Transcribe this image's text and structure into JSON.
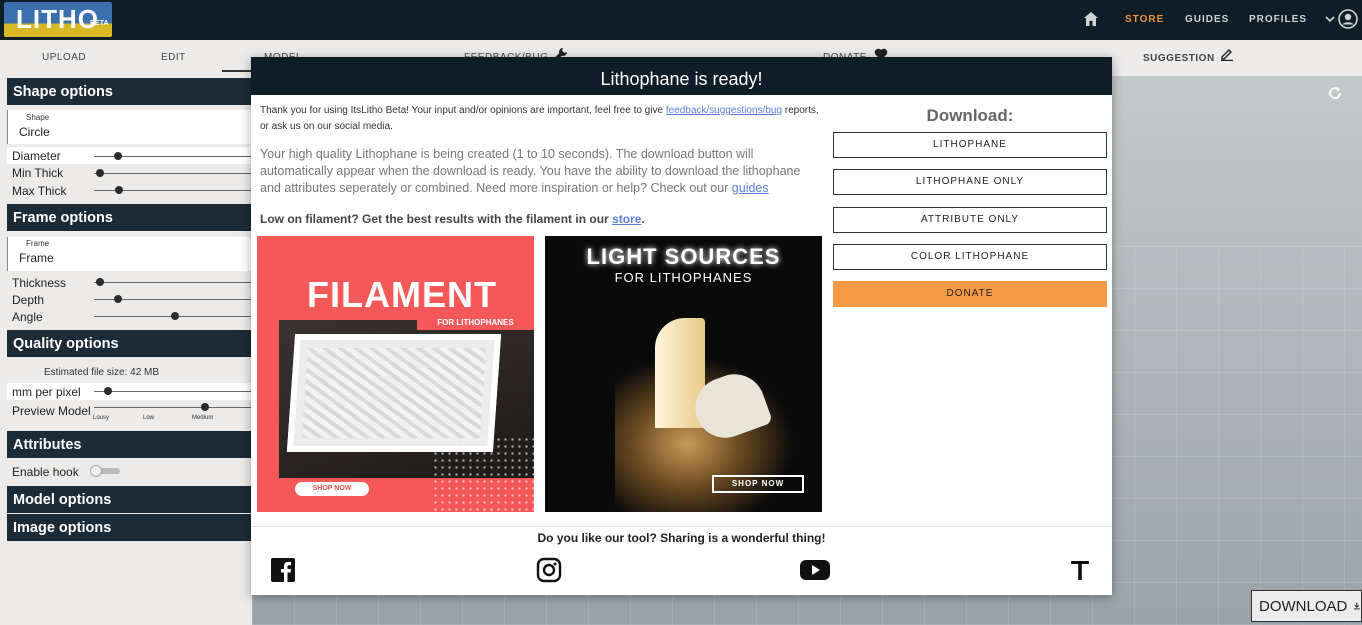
{
  "app": {
    "logo_text": "LITHO",
    "logo_badge": "BETA"
  },
  "nav": {
    "links": [
      "STORE",
      "GUIDES",
      "PROFILES"
    ],
    "accent_color": "#f0913a"
  },
  "tabs": {
    "items": [
      "UPLOAD",
      "EDIT",
      "MODEL",
      "FEEDBACK/BUG",
      "DONATE",
      "SUGGESTION"
    ],
    "active": "MODEL"
  },
  "sidebar": {
    "shape_section": "Shape options",
    "shape_label": "Shape",
    "shape_value": "Circle",
    "diameter": "Diameter",
    "diameter_level": 0.15,
    "min_thick": "Min Thick",
    "min_thick_level": 0.04,
    "max_thick": "Max Thick",
    "max_thick_level": 0.16,
    "frame_section": "Frame options",
    "frame_label": "Frame",
    "frame_value": "Frame",
    "thickness": "Thickness",
    "thickness_level": 0.04,
    "depth": "Depth",
    "depth_level": 0.15,
    "angle": "Angle",
    "angle_level": 0.51,
    "quality_section": "Quality options",
    "file_size": "Estimated file size: 42 MB",
    "mm_per_pixel": "mm per pixel",
    "mm_per_pixel_level": 0.09,
    "preview_model": "Preview Model",
    "preview_model_level": 0.7,
    "preview_ticks": [
      "Lousy",
      "Low",
      "Medium"
    ],
    "attributes_section": "Attributes",
    "enable_hook": "Enable hook",
    "model_section": "Model options",
    "image_section": "Image options"
  },
  "viewport": {
    "download_label": "DOWNLOAD"
  },
  "modal": {
    "title": "Lithophane is ready!",
    "intro_1": "Thank you for using ItsLitho Beta! Your input and/or opinions are important, feel free to give ",
    "intro_link": "feedback/suggestions/bug",
    "intro_2": " reports, or ask us on our social media.",
    "body_1": "Your high quality Lithophane is being created (1 to 10 seconds). The download button will automatically appear when the download is ready. You have the ability to download the lithophane and attributes seperately or combined. Need more inspiration or help? Check out our ",
    "body_link": "guides",
    "low_text": "Low on filament? Get the best results with the filament in our ",
    "low_link": "store",
    "low_end": ".",
    "ad_filament": {
      "title": "FILAMENT",
      "tag": "FOR LITHOPHANES",
      "button": "SHOP NOW"
    },
    "ad_light": {
      "title": "LIGHT SOURCES",
      "subtitle": "FOR LITHOPHANES",
      "button": "SHOP NOW"
    },
    "download_title": "Download:",
    "download_buttons": [
      "LITHOPHANE",
      "LITHOPHANE ONLY",
      "ATTRIBUTE ONLY",
      "COLOR LITHOPHANE",
      "DONATE"
    ],
    "donate_color": "#f79a45",
    "share_text": "Do you like our tool? Sharing is a wonderful thing!",
    "social": [
      "facebook-icon",
      "instagram-icon",
      "youtube-icon",
      "tiktok-icon"
    ]
  }
}
